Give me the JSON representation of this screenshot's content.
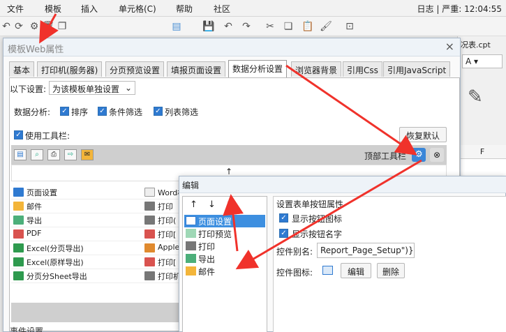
{
  "menubar": {
    "items": [
      "文件",
      "模板",
      "插入",
      "单元格(C)",
      "帮助",
      "社区"
    ],
    "log_label": "日志",
    "error_label": "严重",
    "time": "12:04:55"
  },
  "background": {
    "file_tab_fragment": "况表.cpt",
    "col_header": "F"
  },
  "dialog": {
    "title": "模板Web属性",
    "tabs": [
      "基本",
      "打印机(服务器)",
      "分页预览设置",
      "填报页面设置",
      "数据分析设置",
      "浏览器背景",
      "引用Css",
      "引用JavaScript"
    ],
    "active_tab": 4,
    "settings_label": "以下设置:",
    "settings_select": "为该模板单独设置",
    "analysis_label": "数据分析:",
    "checks": [
      "排序",
      "条件筛选",
      "列表筛选"
    ],
    "use_toolbar": "使用工具栏:",
    "restore_default": "恢复默认",
    "top_toolbar": "顶部工具栏",
    "buttons_col1": [
      "页面设置",
      "邮件",
      "导出",
      "PDF",
      "Excel(分页导出)",
      "Excel(原样导出)",
      "分页分Sheet导出"
    ],
    "buttons_col2": [
      "Word格",
      "打印",
      "打印(",
      "打印[",
      "Apple",
      "打印[",
      "打印机"
    ],
    "event_label": "事件设置"
  },
  "edit_dialog": {
    "title": "编辑",
    "items": [
      "页面设置",
      "打印预览",
      "打印",
      "导出",
      "邮件"
    ],
    "selected_index": 0,
    "group_title": "设置表单按钮属性",
    "show_icon": "显示按钮图标",
    "show_name": "显示按钮名字",
    "alias_label": "控件别名:",
    "alias_value": "Report_Page_Setup\")}",
    "icon_label": "控件图标:",
    "edit_button": "编辑",
    "delete_button": "删除"
  },
  "colors": {
    "accent": "#2f7ad1",
    "selection": "#3d8fe0",
    "arrow": "#f0322b"
  }
}
